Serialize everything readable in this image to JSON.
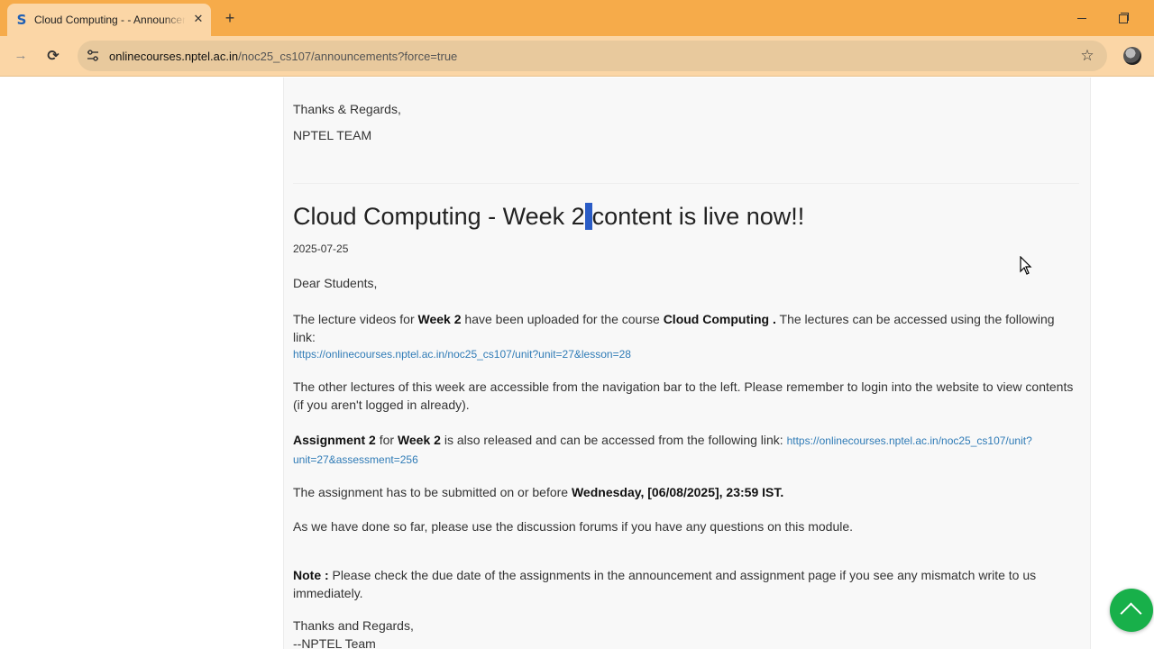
{
  "browser": {
    "tab_title": "Cloud Computing - - Announcements",
    "favicon_letter": "S",
    "new_tab_label": "+",
    "close_label": "✕",
    "url_host": "onlinecourses.nptel.ac.in",
    "url_path": "/noc25_cs107/announcements?force=true",
    "star_label": "☆",
    "forward_label": "→",
    "reload_label": "⟳"
  },
  "prev_announcement": {
    "closing": "Thanks & Regards,",
    "signature": "NPTEL TEAM"
  },
  "announcement": {
    "title_before_caret": "Cloud Computing - Week 2",
    "title_after_caret": "content is live now!!",
    "date": "2025-07-25",
    "greeting": "Dear Students,",
    "p1_a": "The lecture videos for ",
    "p1_b": "Week 2",
    "p1_c": " have been uploaded for the course ",
    "p1_d": "Cloud Computing .",
    "p1_e": " The lectures can be accessed using the following link:",
    "lecture_link": "https://onlinecourses.nptel.ac.in/noc25_cs107/unit?unit=27&lesson=28",
    "p2": "The other lectures of this week are accessible from the navigation bar to the left. Please remember to login into the website to view contents (if you aren't logged in already).",
    "p3_a": "Assignment 2",
    "p3_b": " for ",
    "p3_c": "Week 2",
    "p3_d": " is also released and can be accessed from the following link: ",
    "assignment_link": "https://onlinecourses.nptel.ac.in/noc25_cs107/unit?unit=27&assessment=256",
    "p4_a": "The assignment has to be submitted on or before ",
    "p4_b": "Wednesday, [06/08/2025], 23:59 IST.",
    "p5": "As we have done so far, please use the discussion forums if you have any questions on this module.",
    "note_label": "Note :",
    "note_text": " Please check the due date of the assignments in the announcement and assignment page if you see any mismatch write to us immediately.",
    "closing": "Thanks and Regards,",
    "signature": "--NPTEL Team"
  },
  "colors": {
    "tabbar": "#f6ab4a",
    "toolbar": "#fbd6a6",
    "link": "#2f7bb6",
    "scroll_button": "#18b04a"
  },
  "icons": [
    "favicon-s-icon",
    "close-icon",
    "plus-icon",
    "minimize-icon",
    "restore-icon",
    "forward-icon",
    "reload-icon",
    "site-info-icon",
    "star-icon",
    "profile-avatar",
    "chevron-up-icon",
    "mouse-cursor-icon"
  ]
}
